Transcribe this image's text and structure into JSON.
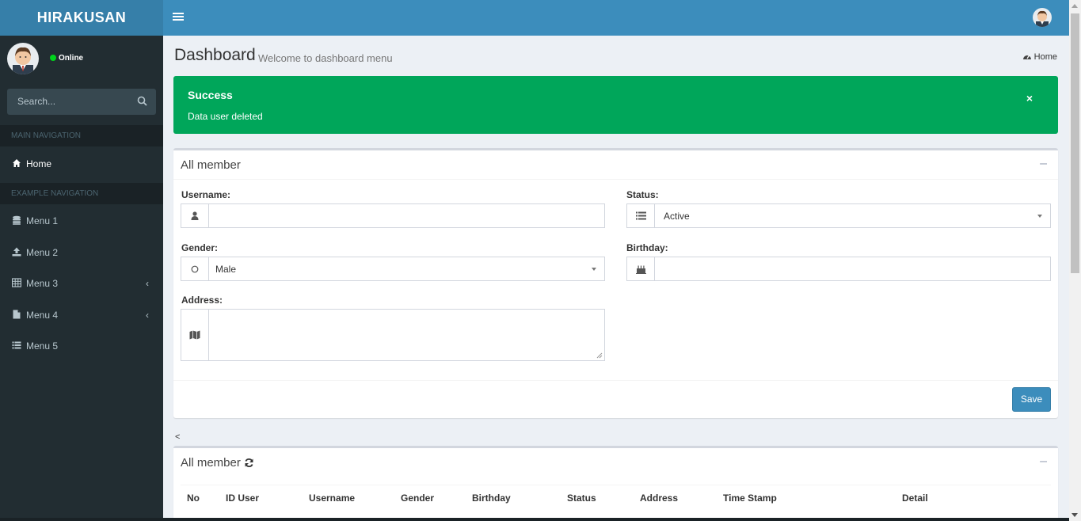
{
  "app": {
    "logo": "HIRAKUSAN"
  },
  "sidebar": {
    "status": "Online",
    "search_placeholder": "Search...",
    "main_header": "MAIN NAVIGATION",
    "example_header": "EXAMPLE NAVIGATION",
    "home": "Home",
    "items": [
      {
        "label": "Menu 1",
        "icon": "database-icon",
        "has_children": false
      },
      {
        "label": "Menu 2",
        "icon": "upload-icon",
        "has_children": false
      },
      {
        "label": "Menu 3",
        "icon": "table-icon",
        "has_children": true
      },
      {
        "label": "Menu 4",
        "icon": "file-icon",
        "has_children": true
      },
      {
        "label": "Menu 5",
        "icon": "list-icon",
        "has_children": false
      }
    ]
  },
  "page": {
    "title": "Dashboard",
    "subtitle": "Welcome to dashboard menu",
    "breadcrumb": "Home"
  },
  "alert": {
    "title": "Success",
    "message": "Data user deleted",
    "close": "×",
    "color": "#00a65a"
  },
  "form": {
    "box_title": "All member",
    "username_label": "Username:",
    "username_value": "",
    "status_label": "Status:",
    "status_value": "Active",
    "gender_label": "Gender:",
    "gender_value": "Male",
    "birthday_label": "Birthday:",
    "birthday_value": "",
    "address_label": "Address:",
    "address_value": "",
    "save_label": "Save"
  },
  "pager_prev": "<",
  "table": {
    "box_title": "All member",
    "columns": [
      "No",
      "ID User",
      "Username",
      "Gender",
      "Birthday",
      "Status",
      "Address",
      "Time Stamp",
      "Detail"
    ]
  },
  "colors": {
    "primary": "#3c8dbc",
    "sidebar": "#222d32",
    "success": "#00a65a"
  }
}
